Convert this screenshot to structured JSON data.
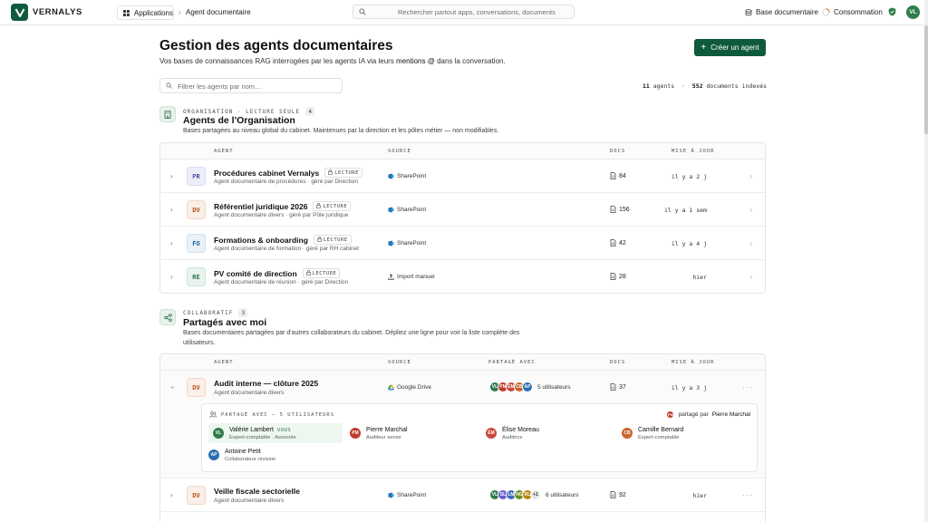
{
  "app": {
    "brand": "VERNALYS",
    "accent": "#0f5a3c"
  },
  "topbar": {
    "apps_label": "Applications",
    "breadcrumb": "Agent documentaire",
    "search_placeholder": "Rechercher partout apps, conversations, documents",
    "base_doc_label": "Base documentaire",
    "consumption_label": "Consommation",
    "user_initials": "VL"
  },
  "page": {
    "title": "Gestion des agents documentaires",
    "subtitle_before": "Vos bases de connaissances RAG interrogées par les agents IA via leurs ",
    "subtitle_mention": "mentions @",
    "subtitle_after": " dans la conversation.",
    "create_button": "Créer un agent",
    "filter_placeholder": "Filtrer les agents par nom…",
    "stats": {
      "agents_count": "11",
      "agents_label": "agents",
      "sep": "·",
      "docs_count": "552",
      "docs_label": "documents indexés"
    }
  },
  "org_section": {
    "kicker": "ORGANISATION · LECTURE SEULE",
    "count": "4",
    "title": "Agents de l'Organisation",
    "desc": "Bases partagées au niveau global du cabinet. Maintenues par la direction et les pôles métier — non modifiables.",
    "headers": {
      "agent": "AGENT",
      "source": "SOURCE",
      "docs": "DOCS",
      "updated": "MISE À JOUR"
    },
    "rows": [
      {
        "initials": "PR",
        "name": "Procédures cabinet Vernalys",
        "badge": "LECTURE",
        "sub": "Agent documentaire de procédures · géré par Direction",
        "source": "SharePoint",
        "docs": "84",
        "updated": "il y a 2 j"
      },
      {
        "initials": "DV",
        "name": "Référentiel juridique 2026",
        "badge": "LECTURE",
        "sub": "Agent documentaire divers · géré par Pôle juridique",
        "source": "SharePoint",
        "docs": "156",
        "updated": "il y a 1 sem"
      },
      {
        "initials": "FO",
        "name": "Formations & onboarding",
        "badge": "LECTURE",
        "sub": "Agent documentaire de formation · géré par RH cabinet",
        "source": "SharePoint",
        "docs": "42",
        "updated": "il y a 4 j"
      },
      {
        "initials": "RE",
        "name": "PV comité de direction",
        "badge": "LECTURE",
        "sub": "Agent documentaire de réunion · géré par Direction",
        "source": "Import manuel",
        "docs": "28",
        "updated": "hier"
      }
    ]
  },
  "shared_section": {
    "kicker": "COLLABORATIF",
    "count": "3",
    "title": "Partagés avec moi",
    "desc_line1": "Bases documentaires partagées par d'autres collaborateurs du cabinet. Dépliez une ligne pour voir la liste complète des",
    "desc_line2": "utilisateurs.",
    "headers": {
      "agent": "AGENT",
      "source": "SOURCE",
      "shared": "PARTAGÉ AVEC",
      "docs": "DOCS",
      "updated": "MISE À JOUR"
    },
    "rows": [
      {
        "initials": "DV",
        "name": "Audit interne — clôture 2025",
        "sub": "Agent documentaire divers",
        "source": "Google Drive",
        "avatars": [
          "VL",
          "PM",
          "ÉM",
          "CB",
          "AP"
        ],
        "shared_text": "5 utilisateurs",
        "docs": "37",
        "updated": "il y a 3 j"
      },
      {
        "initials": "DV",
        "name": "Veille fiscale sectorielle",
        "sub": "Agent documentaire divers",
        "source": "SharePoint",
        "avatars": [
          "VL",
          "SL",
          "LM",
          "NG",
          "RL"
        ],
        "extra": "+1",
        "shared_text": "6 utilisateurs",
        "docs": "92",
        "updated": "hier"
      }
    ],
    "expanded": {
      "kicker": "PARTAGÉ AVEC — 5 UTILISATEURS",
      "shared_by_label": "partagé par",
      "shared_by_name": "Pierre Marchal",
      "shared_by_initials": "PM",
      "users": [
        {
          "initials": "VL",
          "name": "Valérie Lambert",
          "you": "VOUS",
          "role": "Expert-comptable · Associée",
          "color": "#2f7d4a"
        },
        {
          "initials": "PM",
          "name": "Pierre Marchal",
          "role": "Auditeur senior",
          "color": "#c0392b"
        },
        {
          "initials": "ÉM",
          "name": "Élise Moreau",
          "role": "Auditrice",
          "color": "#c84a3a"
        },
        {
          "initials": "CB",
          "name": "Camille Bernard",
          "role": "Expert-comptable",
          "color": "#c8652a"
        },
        {
          "initials": "AP",
          "name": "Antoine Petit",
          "role": "Collaborateur révision",
          "color": "#2b6fb0"
        }
      ]
    }
  }
}
